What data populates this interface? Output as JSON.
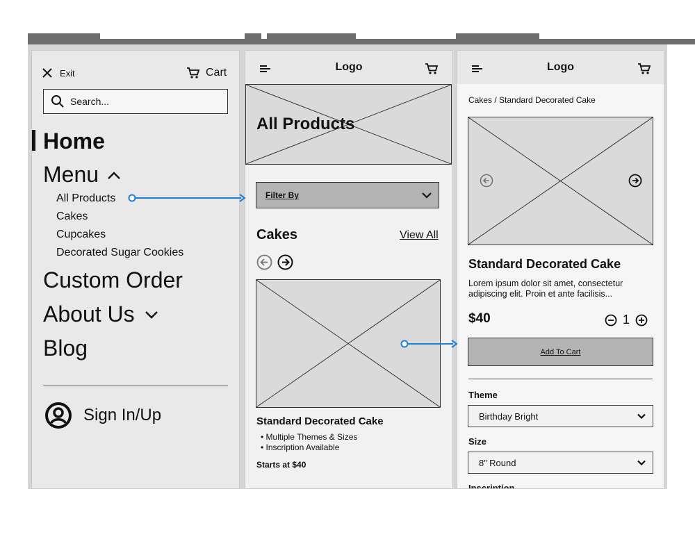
{
  "menu_screen": {
    "exit_label": "Exit",
    "cart_label": "Cart",
    "search_placeholder": "Search...",
    "home_label": "Home",
    "menu_label": "Menu",
    "submenu": [
      "All Products",
      "Cakes",
      "Cupcakes",
      "Decorated Sugar Cookies"
    ],
    "custom_order_label": "Custom Order",
    "about_label": "About Us",
    "blog_label": "Blog",
    "sign_in_label": "Sign In/Up"
  },
  "products_screen": {
    "logo": "Logo",
    "hero_title": "All Products",
    "filter_label": "Filter By",
    "section_title": "Cakes",
    "view_all_label": "View All",
    "product_title": "Standard Decorated Cake",
    "bullets": [
      "Multiple Themes & Sizes",
      "Inscription Available"
    ],
    "price_text": "Starts at $40"
  },
  "detail_screen": {
    "logo": "Logo",
    "breadcrumb": "Cakes / Standard Decorated Cake",
    "title": "Standard Decorated Cake",
    "description": "Lorem ipsum dolor sit amet, consectetur adipiscing elit. Proin et ante facilisis...",
    "price": "$40",
    "quantity": "1",
    "add_to_cart_label": "Add To Cart",
    "theme_label": "Theme",
    "theme_value": "Birthday Bright",
    "size_label": "Size",
    "size_value": "8” Round",
    "cut_off_label": "Inscription"
  },
  "colors": {
    "connector": "#1e7fd8",
    "placeholder": "#dadada",
    "button": "#b4b4b4"
  }
}
